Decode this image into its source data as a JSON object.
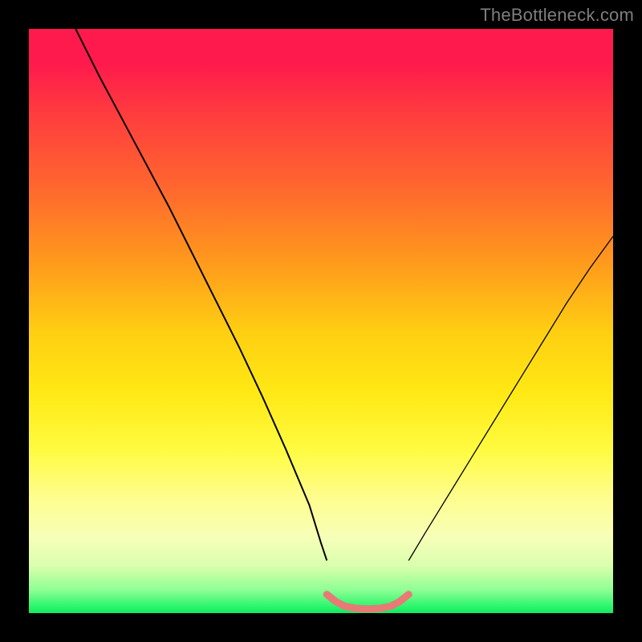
{
  "watermark": {
    "text": "TheBottleneck.com"
  },
  "chart_data": {
    "type": "line",
    "title": "",
    "xlabel": "",
    "ylabel": "",
    "xlim": [
      0,
      100
    ],
    "ylim": [
      0,
      100
    ],
    "grid": false,
    "legend": false,
    "background": {
      "note": "vertical rainbow gradient red→orange→yellow→pale-green→green",
      "colors_top_to_bottom": [
        "#ff1a4d",
        "#ff6a2d",
        "#ffcf12",
        "#fffb40",
        "#d9ffad",
        "#27f56b"
      ]
    },
    "series": [
      {
        "name": "curve-left",
        "stroke": "#000000",
        "stroke_width": 2,
        "x": [
          8,
          12,
          16,
          20,
          24,
          28,
          32,
          36,
          40,
          44,
          48,
          50,
          51
        ],
        "y_pct": [
          100,
          92,
          84.5,
          77,
          69.5,
          61.5,
          53.5,
          45.5,
          37,
          28,
          18.5,
          12,
          9
        ]
      },
      {
        "name": "flat-bottom",
        "stroke": "#e77a76",
        "stroke_width": 9,
        "linecap": "round",
        "x": [
          51,
          52.5,
          54,
          56,
          58,
          60,
          62,
          63.5,
          65
        ],
        "y_pct": [
          3.2,
          2.0,
          1.2,
          0.8,
          0.7,
          0.8,
          1.2,
          2.0,
          3.2
        ]
      },
      {
        "name": "curve-right",
        "stroke": "#000000",
        "stroke_width": 1.3,
        "x": [
          65,
          68,
          72,
          76,
          80,
          84,
          88,
          92,
          96,
          100
        ],
        "y_pct": [
          9,
          14,
          20.5,
          27,
          33.5,
          40,
          46.5,
          53,
          59,
          64.5
        ]
      }
    ],
    "frame": {
      "border_color": "#000000",
      "border_width_px": 36
    }
  }
}
